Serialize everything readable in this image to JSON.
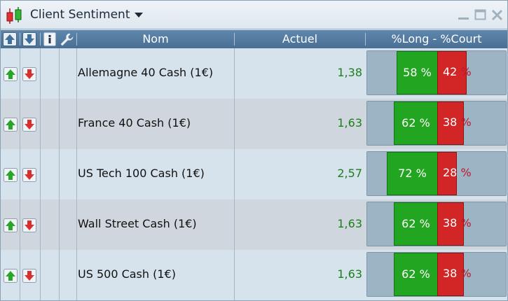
{
  "window": {
    "title": "Client Sentiment"
  },
  "header": {
    "name_col": "Nom",
    "current_col": "Actuel",
    "sentiment_col": "%Long - %Court"
  },
  "rows": [
    {
      "name": "Allemagne 40 Cash (1€)",
      "value": "1,38",
      "long": 58,
      "short": 42,
      "long_label": "58 %",
      "short_num": "42",
      "short_sign": "%"
    },
    {
      "name": "France 40 Cash (1€)",
      "value": "1,63",
      "long": 62,
      "short": 38,
      "long_label": "62 %",
      "short_num": "38",
      "short_sign": "%"
    },
    {
      "name": "US Tech 100 Cash (1€)",
      "value": "2,57",
      "long": 72,
      "short": 28,
      "long_label": "72 %",
      "short_num": "28",
      "short_sign": "%"
    },
    {
      "name": "Wall Street Cash (1€)",
      "value": "1,63",
      "long": 62,
      "short": 38,
      "long_label": "62 %",
      "short_num": "38",
      "short_sign": "%"
    },
    {
      "name": "US 500 Cash (1€)",
      "value": "1,63",
      "long": 62,
      "short": 38,
      "long_label": "62 %",
      "short_num": "38",
      "short_sign": "%"
    }
  ],
  "colors": {
    "long": "#22a622",
    "short": "#d22626",
    "value_text": "#1b7f1b",
    "header_bg": "#4f759b"
  }
}
